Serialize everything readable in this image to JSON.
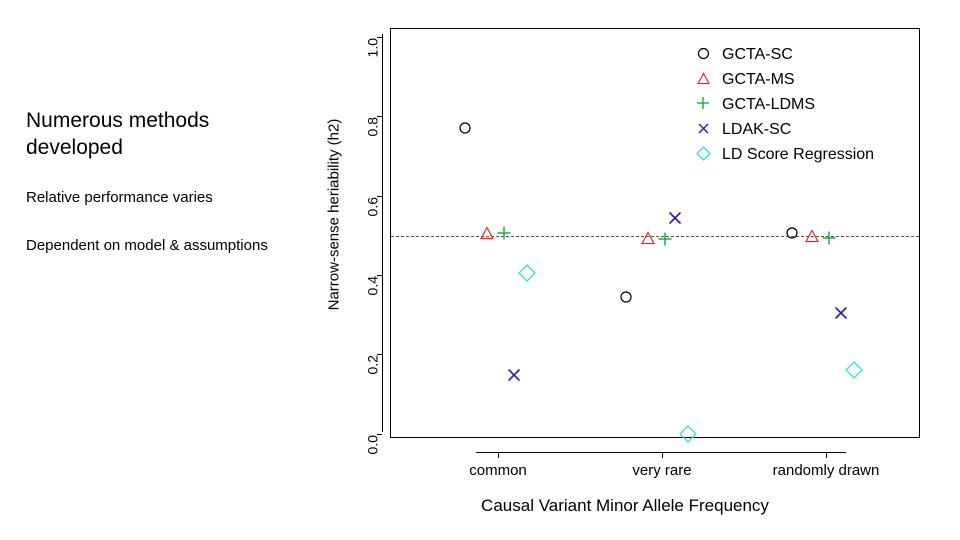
{
  "slide": {
    "bullets": [
      {
        "text": "Numerous methods developed",
        "style": "major"
      },
      {
        "text": "Relative performance varies",
        "style": "minor"
      },
      {
        "text": "Dependent on model & assumptions",
        "style": "minor"
      }
    ]
  },
  "chart_data": {
    "type": "scatter",
    "title": "",
    "xlabel": "Causal Variant Minor Allele Frequency",
    "ylabel": "Narrow-sense heriability (h2)",
    "categories": [
      "common",
      "very rare",
      "randomly drawn"
    ],
    "ylim": [
      0.0,
      1.0
    ],
    "yticks": [
      "0.0",
      "0.2",
      "0.4",
      "0.6",
      "0.8",
      "1.0"
    ],
    "grid": false,
    "legend_position": "top-right",
    "reference_line": {
      "y": 0.5,
      "style": "dashed",
      "color": "#555555"
    },
    "series": [
      {
        "name": "GCTA-SC",
        "marker": "circle",
        "color": "#000000",
        "values": [
          0.77,
          0.345,
          0.505
        ]
      },
      {
        "name": "GCTA-MS",
        "marker": "triangle",
        "color": "#ee2222",
        "values": [
          0.505,
          0.493,
          0.497
        ]
      },
      {
        "name": "GCTA-LDMS",
        "marker": "plus",
        "color": "#22aa44",
        "values": [
          0.505,
          0.491,
          0.494
        ]
      },
      {
        "name": "LDAK-SC",
        "marker": "cross",
        "color": "#2222aa",
        "values": [
          0.133,
          0.545,
          0.305
        ]
      },
      {
        "name": "LD Score Regression",
        "marker": "diamond",
        "color": "#33dddd",
        "values": [
          0.408,
          0.002,
          0.164
        ]
      }
    ]
  }
}
